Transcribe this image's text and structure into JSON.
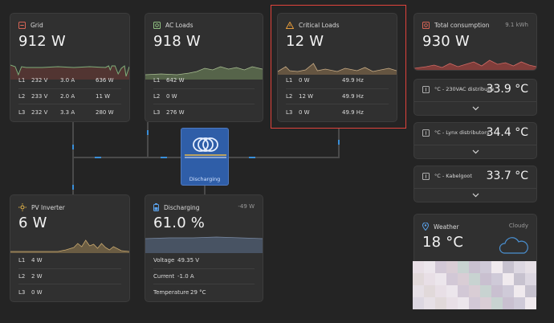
{
  "grid": {
    "title": "Grid",
    "value": "912 W",
    "rows": [
      {
        "phase": "L1",
        "volt": "232 V",
        "amp": "3.0 A",
        "watt": "636 W"
      },
      {
        "phase": "L2",
        "volt": "233 V",
        "amp": "2.0 A",
        "watt": "11 W"
      },
      {
        "phase": "L3",
        "volt": "232 V",
        "amp": "3.3 A",
        "watt": "280 W"
      }
    ]
  },
  "ac_loads": {
    "title": "AC Loads",
    "value": "918 W",
    "rows": [
      {
        "phase": "L1",
        "watt": "642 W"
      },
      {
        "phase": "L2",
        "watt": "0 W"
      },
      {
        "phase": "L3",
        "watt": "276 W"
      }
    ]
  },
  "critical_loads": {
    "title": "Critical Loads",
    "value": "12 W",
    "rows": [
      {
        "phase": "L1",
        "watt": "0 W",
        "freq": "49.9 Hz"
      },
      {
        "phase": "L2",
        "watt": "12 W",
        "freq": "49.9 Hz"
      },
      {
        "phase": "L3",
        "watt": "0 W",
        "freq": "49.9 Hz"
      }
    ]
  },
  "total_consumption": {
    "title": "Total consumption",
    "energy": "9.1 kWh",
    "value": "930 W"
  },
  "temperatures": [
    {
      "label": "°C - 230VAC distributie",
      "value": "33.9 °C"
    },
    {
      "label": "°C - Lynx distributors",
      "value": "34.4 °C"
    },
    {
      "label": "°C - Kabelgoot",
      "value": "33.7 °C"
    }
  ],
  "weather": {
    "title": "Weather",
    "condition": "Cloudy",
    "value": "18 °C"
  },
  "inverter": {
    "label": "Discharging"
  },
  "pv_inverter": {
    "title": "PV Inverter",
    "value": "6 W",
    "rows": [
      {
        "phase": "L1",
        "watt": "4 W"
      },
      {
        "phase": "L2",
        "watt": "2 W"
      },
      {
        "phase": "L3",
        "watt": "0 W"
      }
    ]
  },
  "battery": {
    "title": "Discharging",
    "power": "-49 W",
    "value": "61.0 %",
    "rows": [
      {
        "label": "Voltage",
        "value": "49.35 V"
      },
      {
        "label": "Current",
        "value": "-1.0 A"
      },
      {
        "label": "Temperature",
        "value": "29 °C"
      }
    ]
  },
  "colors": {
    "accent_red": "#e0433c",
    "accent_blue": "#3a8fd9",
    "grid_icon": "#e86a5a",
    "ac_icon": "#9ad08a",
    "critical_icon": "#e39a3a",
    "pv_icon": "#e8b84a",
    "battery_icon": "#5aa0e8"
  },
  "icons": [
    "grid-icon",
    "ac-loads-icon",
    "warning-icon",
    "total-consumption-icon",
    "thermometer-icon",
    "chevron-down-icon",
    "location-pin-icon",
    "cloud-icon",
    "sun-icon",
    "battery-icon",
    "inverter-logo"
  ]
}
